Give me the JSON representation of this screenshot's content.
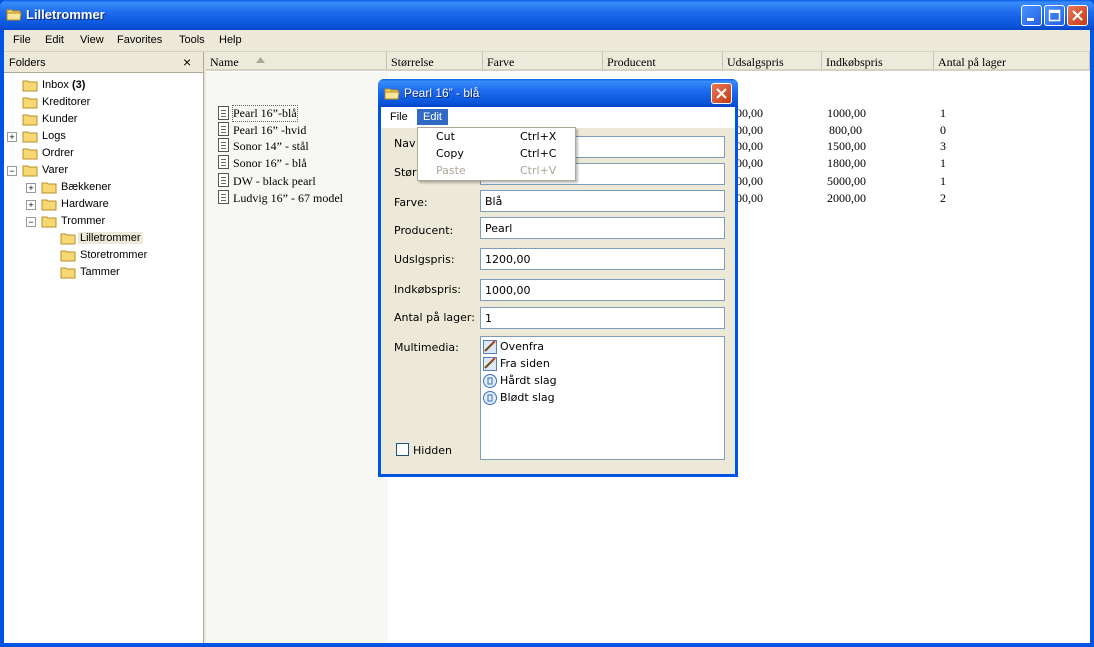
{
  "window": {
    "title": "Lilletrommer"
  },
  "menu": [
    {
      "label": "File",
      "u": "F"
    },
    {
      "label": "Edit",
      "u": "E"
    },
    {
      "label": "View",
      "u": "V"
    },
    {
      "label": "Favorites",
      "u": "a"
    },
    {
      "label": "Tools",
      "u": "T"
    },
    {
      "label": "Help",
      "u": "H"
    }
  ],
  "folders": {
    "header": "Folders",
    "close": "×",
    "items": [
      {
        "label": "Inbox",
        "count": "(3)"
      },
      {
        "label": "Kreditorer"
      },
      {
        "label": "Kunder"
      },
      {
        "label": "Logs"
      },
      {
        "label": "Ordrer"
      },
      {
        "label": "Varer"
      },
      {
        "label": "Bækkener"
      },
      {
        "label": "Hardware"
      },
      {
        "label": "Trommer"
      },
      {
        "label": "Lilletrommer"
      },
      {
        "label": "Storetrommer"
      },
      {
        "label": "Tammer"
      }
    ]
  },
  "list": {
    "columns": [
      "Name",
      "Størrelse",
      "Farve",
      "Producent",
      "Udsalgspris",
      "Indkøbspris",
      "Antal på lager"
    ],
    "rows": [
      {
        "name": "Pearl 16”-blå",
        "udsalg": "00,00",
        "indkob": "1000,00",
        "antal": "1"
      },
      {
        "name": "Pearl 16” -hvid",
        "udsalg": "00,00",
        "indkob": "800,00",
        "antal": "0"
      },
      {
        "name": "Sonor 14” - stål",
        "udsalg": "00,00",
        "indkob": "1500,00",
        "antal": "3"
      },
      {
        "name": "Sonor 16” - blå",
        "udsalg": "00,00",
        "indkob": "1800,00",
        "antal": "1"
      },
      {
        "name": "DW - black pearl",
        "udsalg": "00,00",
        "indkob": "5000,00",
        "antal": "1"
      },
      {
        "name": "Ludvig 16” - 67 model",
        "udsalg": "00,00",
        "indkob": "2000,00",
        "antal": "2"
      }
    ]
  },
  "dialog": {
    "title": "Pearl 16” - blå",
    "menu": {
      "file": "File",
      "edit": "Edit"
    },
    "fields": {
      "navn_label": "Nav",
      "storrelse_label": "Stør",
      "farve_label": "Farve:",
      "farve_value": "Blå",
      "producent_label": "Producent:",
      "producent_value": "Pearl",
      "udsalg_label": "Udslgspris:",
      "udsalg_value": "1200,00",
      "indkob_label": "Indkøbspris:",
      "indkob_value": "1000,00",
      "antal_label": "Antal på lager:",
      "antal_value": "1",
      "multimedia_label": "Multimedia:"
    },
    "multimedia": [
      {
        "label": "Ovenfra",
        "icon": "image-icon"
      },
      {
        "label": "Fra siden",
        "icon": "image-icon"
      },
      {
        "label": "Hårdt slag",
        "icon": "audio-icon"
      },
      {
        "label": "Blødt slag",
        "icon": "audio-icon"
      }
    ],
    "hidden_label": "Hidden"
  },
  "dropdown": [
    {
      "label": "Cut",
      "shortcut": "Ctrl+X",
      "enabled": true
    },
    {
      "label": "Copy",
      "shortcut": "Ctrl+C",
      "enabled": true
    },
    {
      "label": "Paste",
      "shortcut": "Ctrl+V",
      "enabled": false
    }
  ],
  "colors": {
    "titlebar": "#0a55da",
    "menu_highlight": "#316ac5",
    "face": "#ece9d8"
  }
}
